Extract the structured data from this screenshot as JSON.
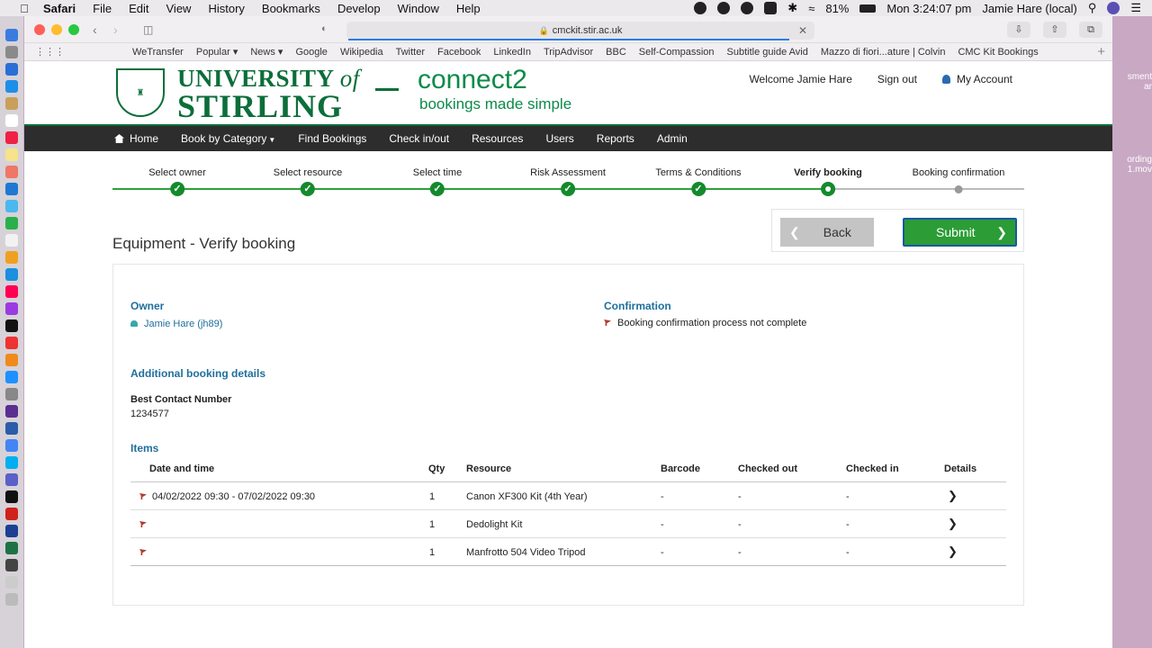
{
  "menubar": {
    "app": "Safari",
    "items": [
      "File",
      "Edit",
      "View",
      "History",
      "Bookmarks",
      "Develop",
      "Window",
      "Help"
    ],
    "battery": "81%",
    "clock": "Mon 3:24:07 pm",
    "user": "Jamie Hare (local)"
  },
  "browser": {
    "url": "cmckit.stir.ac.uk",
    "favorites": [
      "WeTransfer",
      "Popular ▾",
      "News ▾",
      "Google",
      "Wikipedia",
      "Twitter",
      "Facebook",
      "LinkedIn",
      "TripAdvisor",
      "BBC",
      "Self-Compassion",
      "Subtitle guide Avid",
      "Mazzo di fiori...ature | Colvin",
      "CMC Kit Bookings"
    ]
  },
  "desktop": {
    "file_label": "ording\n1.mov",
    "side_label": "sment\nar"
  },
  "header": {
    "uni_line1": "UNIVERSITY",
    "uni_of": "of",
    "uni_line2": "STIRLING",
    "brand": "connect2",
    "tagline": "bookings made simple",
    "welcome": "Welcome Jamie Hare",
    "signout": "Sign out",
    "account": "My Account"
  },
  "nav": {
    "home": "Home",
    "category": "Book by Category",
    "find": "Find Bookings",
    "check": "Check in/out",
    "resources": "Resources",
    "users": "Users",
    "reports": "Reports",
    "admin": "Admin"
  },
  "steps": [
    {
      "label": "Select owner",
      "state": "done"
    },
    {
      "label": "Select resource",
      "state": "done"
    },
    {
      "label": "Select time",
      "state": "done"
    },
    {
      "label": "Risk Assessment",
      "state": "done"
    },
    {
      "label": "Terms & Conditions",
      "state": "done"
    },
    {
      "label": "Verify booking",
      "state": "current"
    },
    {
      "label": "Booking confirmation",
      "state": "todo"
    }
  ],
  "buttons": {
    "back": "Back",
    "submit": "Submit"
  },
  "title": "Equipment - Verify booking",
  "owner": {
    "heading": "Owner",
    "name": "Jamie Hare (jh89)"
  },
  "confirmation": {
    "heading": "Confirmation",
    "text": "Booking confirmation process not complete"
  },
  "additional": {
    "heading": "Additional booking details",
    "label": "Best Contact Number",
    "value": "1234577"
  },
  "items": {
    "heading": "Items",
    "columns": [
      "Date and time",
      "Qty",
      "Resource",
      "Barcode",
      "Checked out",
      "Checked in",
      "Details"
    ],
    "rows": [
      {
        "date": "04/02/2022 09:30 - 07/02/2022 09:30",
        "qty": "1",
        "resource": "Canon XF300 Kit (4th Year)",
        "barcode": "-",
        "out": "-",
        "in": "-"
      },
      {
        "date": "",
        "qty": "1",
        "resource": "Dedolight Kit",
        "barcode": "-",
        "out": "-",
        "in": "-"
      },
      {
        "date": "",
        "qty": "1",
        "resource": "Manfrotto 504 Video Tripod",
        "barcode": "-",
        "out": "-",
        "in": "-"
      }
    ]
  }
}
